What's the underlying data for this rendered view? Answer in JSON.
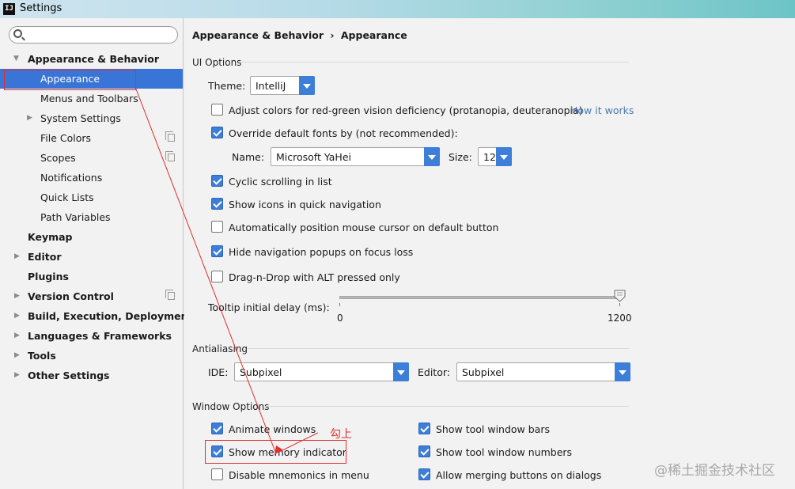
{
  "window": {
    "title": "Settings",
    "app_icon": "IJ"
  },
  "search": {
    "placeholder": "",
    "value": ""
  },
  "sidebar": {
    "items": [
      {
        "label": "Appearance & Behavior",
        "bold": true,
        "expander": "expanded"
      },
      {
        "label": "Appearance",
        "selected": true
      },
      {
        "label": "Menus and Toolbars"
      },
      {
        "label": "System Settings",
        "expander": "collapsed"
      },
      {
        "label": "File Colors",
        "copy_icon": true
      },
      {
        "label": "Scopes",
        "copy_icon": true
      },
      {
        "label": "Notifications"
      },
      {
        "label": "Quick Lists"
      },
      {
        "label": "Path Variables"
      },
      {
        "label": "Keymap",
        "bold": true
      },
      {
        "label": "Editor",
        "bold": true,
        "expander": "collapsed"
      },
      {
        "label": "Plugins",
        "bold": true
      },
      {
        "label": "Version Control",
        "bold": true,
        "expander": "collapsed",
        "copy_icon": true
      },
      {
        "label": "Build, Execution, Deployment",
        "bold": true,
        "expander": "collapsed"
      },
      {
        "label": "Languages & Frameworks",
        "bold": true,
        "expander": "collapsed"
      },
      {
        "label": "Tools",
        "bold": true,
        "expander": "collapsed"
      },
      {
        "label": "Other Settings",
        "bold": true,
        "expander": "collapsed"
      }
    ]
  },
  "breadcrumb": {
    "parent": "Appearance & Behavior",
    "separator": "›",
    "current": "Appearance"
  },
  "ui_options": {
    "title": "UI Options",
    "theme_label": "Theme:",
    "theme_value": "IntelliJ",
    "adjust_colors": {
      "label": "Adjust colors for red-green vision deficiency (protanopia, deuteranopia)",
      "checked": false,
      "link": "How it works"
    },
    "override_fonts": {
      "label": "Override default fonts by (not recommended):",
      "checked": true
    },
    "font_name_label": "Name:",
    "font_name_value": "Microsoft YaHei",
    "font_size_label": "Size:",
    "font_size_value": "12",
    "cyclic_scrolling": {
      "label": "Cyclic scrolling in list",
      "checked": true
    },
    "show_icons": {
      "label": "Show icons in quick navigation",
      "checked": true
    },
    "auto_position": {
      "label": "Automatically position mouse cursor on default button",
      "checked": false
    },
    "hide_nav_popups": {
      "label": "Hide navigation popups on focus loss",
      "checked": true
    },
    "drag_n_drop": {
      "label": "Drag-n-Drop with ALT pressed only",
      "checked": false
    },
    "tooltip_label": "Tooltip initial delay (ms):",
    "tooltip_min": "0",
    "tooltip_max": "1200",
    "tooltip_value": 1200
  },
  "antialiasing": {
    "title": "Antialiasing",
    "ide_label": "IDE:",
    "ide_value": "Subpixel",
    "editor_label": "Editor:",
    "editor_value": "Subpixel"
  },
  "window_options": {
    "title": "Window Options",
    "animate_windows": {
      "label": "Animate windows",
      "checked": true
    },
    "show_memory": {
      "label": "Show memory indicator",
      "checked": true
    },
    "disable_mnemonics": {
      "label": "Disable mnemonics in menu",
      "checked": false
    },
    "show_tool_bars": {
      "label": "Show tool window bars",
      "checked": true
    },
    "show_tool_numbers": {
      "label": "Show tool window numbers",
      "checked": true
    },
    "allow_merging": {
      "label": "Allow merging buttons on dialogs",
      "checked": true
    }
  },
  "annotation": {
    "text": "勾上",
    "color": "#e03030"
  },
  "watermark": "@稀土掘金技术社区",
  "colors": {
    "accent": "#3d7ed8",
    "selection": "#3875d7",
    "link": "#4a7ab0"
  }
}
